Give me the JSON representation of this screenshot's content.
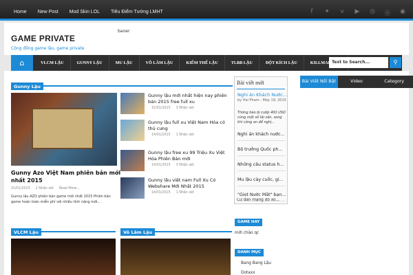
{
  "topnav": [
    "Home",
    "New Post",
    "Mod Skin LOL",
    "Tiêu Điểm Tướng LMHT"
  ],
  "social": [
    "facebook-icon",
    "twitter-icon",
    "vimeo-icon",
    "youtube-icon",
    "dribbble-icon",
    "pinterest-icon",
    "rss-icon"
  ],
  "header": {
    "logo": "GAME PRIVATE",
    "tagline": "Cộng đồng game lậu, game private",
    "banner": "baner"
  },
  "mainnav": [
    "VLCM LẬU",
    "GUNNY LẬU",
    "MU LẬU",
    "VÕ LÂM LẬU",
    "KIẾM THẾ LẬU",
    "TLBB LẬU",
    "ĐỘT KÍCH LẬU",
    "KILLMARK CF"
  ],
  "search": {
    "placeholder": "Text to Search..."
  },
  "gunny": {
    "title": "Gunny Lậu",
    "big": {
      "title": "Gunny Azo Việt Nam phiên bản mới nhất 2015",
      "date": "15/01/2015",
      "comments": "2 Nhận xét",
      "more": "Read More...",
      "desc": "Gunny lậu AZO phiên bản game mới nhất 2015 Phiên bản game hoàn toàn miễn phí với nhiều tính năng mới..."
    },
    "items": [
      {
        "title": "Gunny lậu mới nhất hiện nay phiên bản 2015 free full xu",
        "date": "15/01/2015",
        "comments": "3 Nhận xét"
      },
      {
        "title": "Gunny lậu full xu Việt Nam Hóa có thú cưng",
        "date": "14/01/2015",
        "comments": "1 Nhận xét"
      },
      {
        "title": "Gunny lậu free xu 99 Triệu Xu Việt Hóa Phiên Bản mới",
        "date": "14/01/2015",
        "comments": "3 Nhận xét"
      },
      {
        "title": "Gunny lậu việt nam Full Xu Có Webshare Mới Nhất 2015",
        "date": "14/01/2015",
        "comments": "1 Nhận xét"
      }
    ]
  },
  "vlcm": {
    "title": "VLCM Lậu"
  },
  "volam": {
    "title": "Võ Lâm Lậu"
  },
  "latest": {
    "title": "Bài viết mới",
    "first": {
      "title": "Nghi án Khách Nước...",
      "meta": "by Hai Pham - May 19, 2015",
      "desc": "Thông báo bị cướp 400 USD cùng một số tài sản, song khi công an để nghị..."
    },
    "links": [
      "Nghi án khách nước...",
      "Bộ trưởng Quốc ph...",
      "Những câu status h...",
      "Mu lậu cày cuốc, gi...",
      "\"Giọt Nước Mắt\" bạn...",
      "Cư dân mạng đổ xô..."
    ]
  },
  "tabs": [
    "Bài Viết Nổi Bật",
    "Video",
    "Category"
  ],
  "gamehay": {
    "title": "GAME HAY",
    "text": "mới chào qc"
  },
  "danhmuc": {
    "title": "DANH MỤC",
    "items": [
      "Bang Bang Lậu",
      "Dotaxx"
    ]
  }
}
